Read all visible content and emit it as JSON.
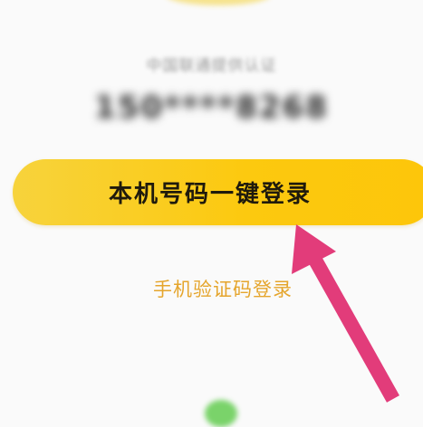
{
  "carrier": {
    "label": "中国联通提供认证"
  },
  "phone": {
    "masked_number": "150****8268"
  },
  "primary_button": {
    "label": "本机号码一键登录"
  },
  "secondary_link": {
    "label": "手机验证码登录"
  },
  "colors": {
    "primary_button": "#fcc90f",
    "secondary_link": "#e5a52c",
    "annotation_arrow": "#e23c7a"
  },
  "icons": {
    "annotation": "arrow-pointer-icon"
  }
}
